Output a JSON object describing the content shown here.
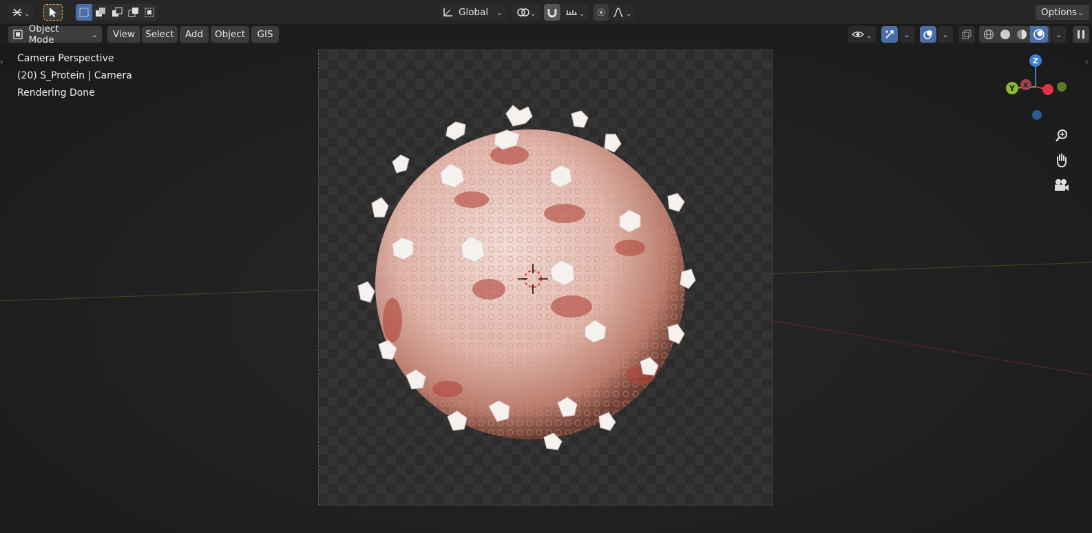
{
  "topbar": {
    "transform_orientation": "Global",
    "options_label": "Options"
  },
  "header": {
    "mode_label": "Object Mode",
    "menus": [
      "View",
      "Select",
      "Add",
      "Object",
      "GIS"
    ]
  },
  "viewport": {
    "overlay_lines": [
      "Camera Perspective",
      "(20) S_Protein | Camera",
      "Rendering Done"
    ]
  },
  "gizmo": {
    "z_label": "Z",
    "y_label": "Y",
    "x_label": "X",
    "colors": {
      "x": "#e0344a",
      "y": "#8cbc2c",
      "z": "#3b82d6"
    }
  },
  "navigation_icons": [
    "zoom-icon",
    "hand-pan-icon",
    "camera-icon"
  ],
  "accent_colors": {
    "active_blue": "#4a6fa8",
    "select_outline": "#f5a623"
  }
}
